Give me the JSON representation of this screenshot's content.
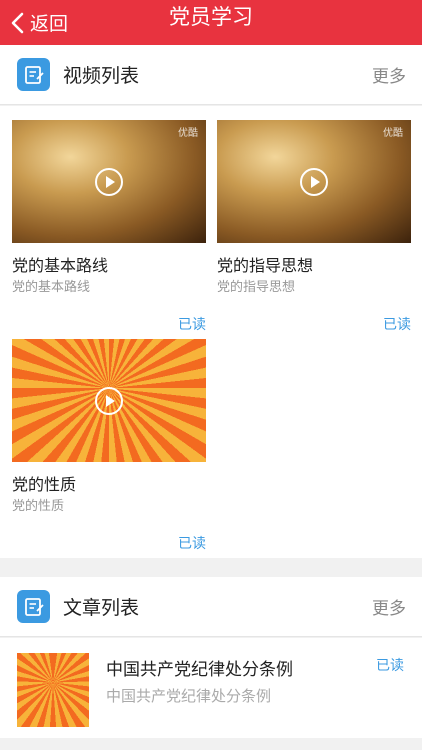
{
  "nav": {
    "back_label": "返回",
    "title": "党员学习"
  },
  "video_section": {
    "title": "视频列表",
    "more": "更多",
    "items": [
      {
        "title": "党的基本路线",
        "subtitle": "党的基本路线",
        "status": "已读",
        "watermark": "优酷"
      },
      {
        "title": "党的指导思想",
        "subtitle": "党的指导思想",
        "status": "已读",
        "watermark": "优酷"
      },
      {
        "title": "党的性质",
        "subtitle": "党的性质",
        "status": "已读",
        "watermark": ""
      }
    ]
  },
  "article_section": {
    "title": "文章列表",
    "more": "更多",
    "items": [
      {
        "title": "中国共产党纪律处分条例",
        "subtitle": "中国共产党纪律处分条例",
        "status": "已读"
      }
    ]
  },
  "colors": {
    "nav_bg": "#e8333f",
    "accent": "#3b9ae1"
  }
}
